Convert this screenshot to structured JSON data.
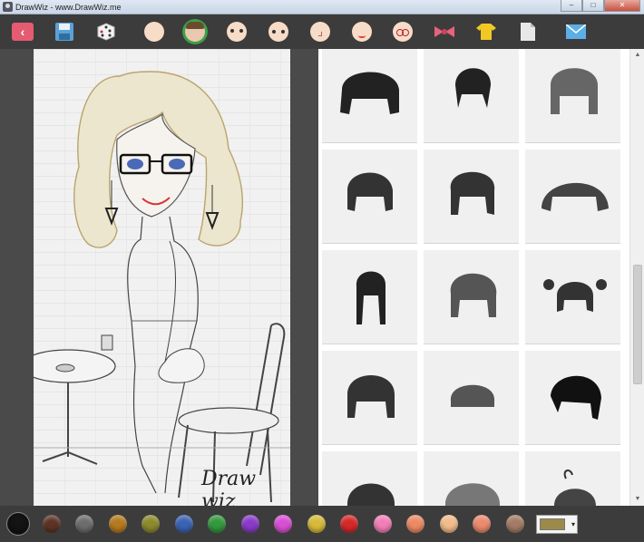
{
  "window": {
    "title": "DrawWiz - www.DrawWiz.me",
    "minimize": "–",
    "maximize": "□",
    "close": "✕"
  },
  "toolbar": {
    "back": "‹",
    "icons": [
      "back-icon",
      "save-icon",
      "random-dice-icon",
      "face-shape-icon",
      "hair-icon",
      "eyebrows-icon",
      "eyes-icon",
      "nose-icon",
      "mouth-icon",
      "glasses-icon",
      "bow-accessory-icon",
      "shirt-icon",
      "page-icon",
      "mail-icon"
    ]
  },
  "canvas": {
    "watermark": "Draw wiz"
  },
  "hair_panel": {
    "rows": 5,
    "columns": 3,
    "tile_count": 15
  },
  "palette": {
    "colors": [
      "#141414",
      "#5c3324",
      "#6d6d6d",
      "#b57a1e",
      "#8c8a2c",
      "#3963b4",
      "#33993c",
      "#8a3ac9",
      "#d94fd3",
      "#d8ba3a",
      "#d62828",
      "#f27eb7",
      "#ec8a64",
      "#f2bc8a",
      "#ea8a6e",
      "#a47b66"
    ],
    "selected_index": 0,
    "current_color": "#9b8a4a",
    "dropdown": "▾"
  },
  "colors": {
    "toolbar": "#3c3c3c",
    "back_button": "#e55b72",
    "selected_ring": "#3ca046"
  }
}
